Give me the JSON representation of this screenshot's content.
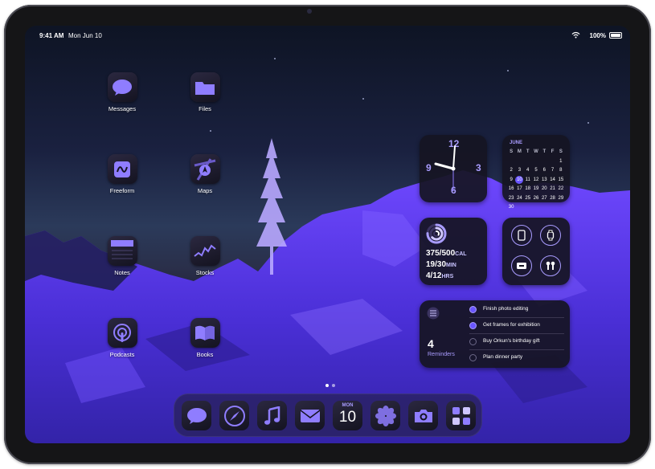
{
  "status_bar": {
    "time": "9:41 AM",
    "date": "Mon Jun 10",
    "battery": "100%"
  },
  "apps": [
    {
      "label": "Messages",
      "icon": "messages-icon"
    },
    {
      "label": "Files",
      "icon": "files-icon"
    },
    {
      "label": "Freeform",
      "icon": "freeform-icon"
    },
    {
      "label": "Maps",
      "icon": "maps-icon"
    },
    {
      "label": "Notes",
      "icon": "notes-icon"
    },
    {
      "label": "Stocks",
      "icon": "stocks-icon"
    },
    {
      "label": "Podcasts",
      "icon": "podcasts-icon"
    },
    {
      "label": "Books",
      "icon": "books-icon"
    }
  ],
  "clock_widget": {
    "numbers": [
      "12",
      "3",
      "6",
      "9"
    ]
  },
  "calendar_widget": {
    "month": "JUNE",
    "weekdays": [
      "S",
      "M",
      "T",
      "W",
      "T",
      "F",
      "S"
    ],
    "days": [
      "",
      "",
      "",
      "",
      "",
      "",
      "1",
      "2",
      "3",
      "4",
      "5",
      "6",
      "7",
      "8",
      "9",
      "10",
      "11",
      "12",
      "13",
      "14",
      "15",
      "16",
      "17",
      "18",
      "19",
      "20",
      "21",
      "22",
      "23",
      "24",
      "25",
      "26",
      "27",
      "28",
      "29",
      "30",
      "",
      "",
      "",
      "",
      "",
      ""
    ],
    "today": "10"
  },
  "fitness_widget": {
    "move": "375/500",
    "move_unit": "CAL",
    "exercise": "19/30",
    "exercise_unit": "MIN",
    "stand": "4/12",
    "stand_unit": "HRS",
    "rings": {
      "move": 0.75,
      "exercise": 0.63,
      "stand": 0.33
    }
  },
  "controls_widget": {
    "icons": [
      "ipad-icon",
      "watch-icon",
      "mac-icon",
      "airpods-icon"
    ]
  },
  "reminders_widget": {
    "count": "4",
    "label": "Reminders",
    "items": [
      {
        "text": "Finish photo editing",
        "done": true
      },
      {
        "text": "Get frames for exhibition",
        "done": true
      },
      {
        "text": "Buy Orkun's birthday gift",
        "done": false
      },
      {
        "text": "Plan dinner party",
        "done": false
      }
    ]
  },
  "dock": {
    "apps": [
      "messages-icon",
      "safari-icon",
      "music-icon",
      "mail-icon",
      "calendar-icon",
      "photos-icon",
      "camera-icon",
      "utilities-icon"
    ],
    "calendar_month": "MON",
    "calendar_day": "10"
  },
  "colors": {
    "accent": "#a99cff",
    "glow": "#5b3cff",
    "widget_bg": "#16142a"
  }
}
